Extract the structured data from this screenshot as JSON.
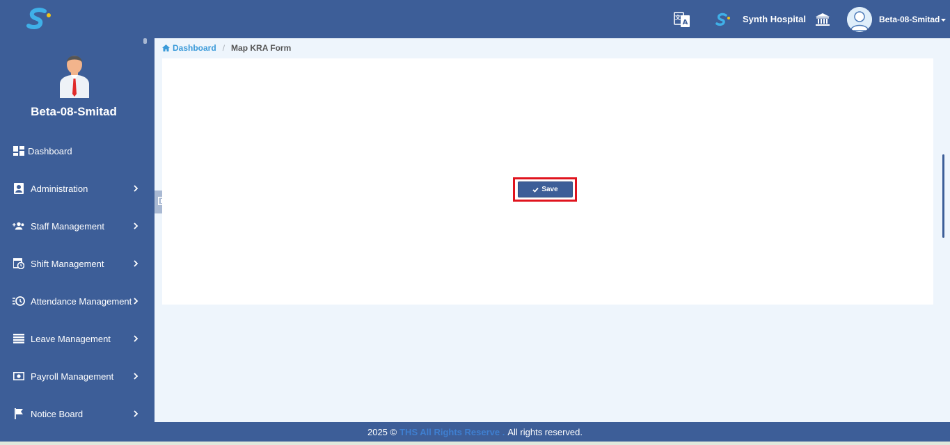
{
  "header": {
    "hospital_name": "Synth Hospital",
    "user_name": "Beta-08-Smitad"
  },
  "sidebar": {
    "user_name": "Beta-08-Smitad",
    "items": [
      {
        "label": "Dashboard"
      },
      {
        "label": "Administration"
      },
      {
        "label": "Staff Management"
      },
      {
        "label": "Shift Management"
      },
      {
        "label": "Attendance Management"
      },
      {
        "label": "Leave Management"
      },
      {
        "label": "Payroll Management"
      },
      {
        "label": "Notice Board"
      }
    ]
  },
  "breadcrumb": {
    "home": "Dashboard",
    "separator": "/",
    "current": "Map KRA Form"
  },
  "form": {
    "save_label": "Save"
  },
  "footer": {
    "prefix": "2025 ©",
    "brand": "THS All Rights Reserve .",
    "suffix": "All rights reserved."
  },
  "colors": {
    "primary": "#3d5e98",
    "accent": "#3a9ad9",
    "highlight": "#e0141e",
    "background": "#eef5fc"
  }
}
